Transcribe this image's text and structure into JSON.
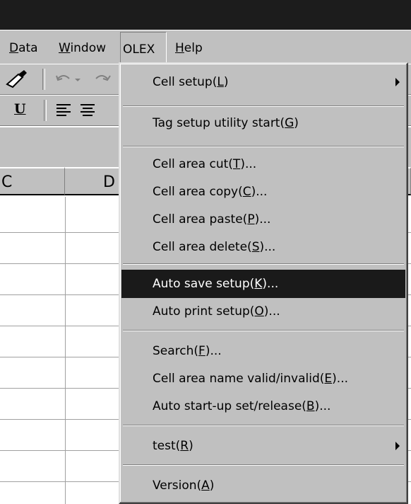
{
  "menubar": {
    "items": [
      {
        "label": "Data",
        "key": "D",
        "rest": "ata"
      },
      {
        "label": "Window",
        "key": "W",
        "rest": "indow"
      },
      {
        "label": "OLEX"
      },
      {
        "label": "Help",
        "key": "H",
        "rest": "elp"
      }
    ]
  },
  "toolbar": {
    "undo_icon": "undo-icon",
    "redo_icon": "redo-icon",
    "brush_icon": "format-painter-icon",
    "underline_label": "U",
    "align_left_icon": "align-left-icon",
    "align_center_icon": "align-center-icon"
  },
  "sheet": {
    "columns": [
      "C",
      "D"
    ]
  },
  "olex_menu": {
    "items": [
      {
        "pre": "Cell setup(",
        "key": "L",
        "post": ")",
        "submenu": true
      },
      {
        "pre": "Tag setup utility start(",
        "key": "G",
        "post": ")"
      },
      {
        "pre": "Cell area cut(",
        "key": "T",
        "post": ")..."
      },
      {
        "pre": "Cell area copy(",
        "key": "C",
        "post": ")..."
      },
      {
        "pre": "Cell area paste(",
        "key": "P",
        "post": ")..."
      },
      {
        "pre": "Cell area delete(",
        "key": "S",
        "post": ")..."
      },
      {
        "pre": "Auto save setup(",
        "key": "K",
        "post": ")...",
        "highlighted": true
      },
      {
        "pre": "Auto print setup(",
        "key": "O",
        "post": ")..."
      },
      {
        "pre": "Search(",
        "key": "F",
        "post": ")..."
      },
      {
        "pre": "Cell area name valid/invalid(",
        "key": "E",
        "post": ")..."
      },
      {
        "pre": "Auto start-up set/release(",
        "key": "B",
        "post": ")..."
      },
      {
        "pre": "test(",
        "key": "R",
        "post": ")",
        "submenu": true
      },
      {
        "pre": "Version(",
        "key": "A",
        "post": ")"
      }
    ]
  },
  "colors": {
    "chrome": "#c0c0c0",
    "titlebar": "#1c1c1c",
    "highlight": "#1a1a1a"
  }
}
